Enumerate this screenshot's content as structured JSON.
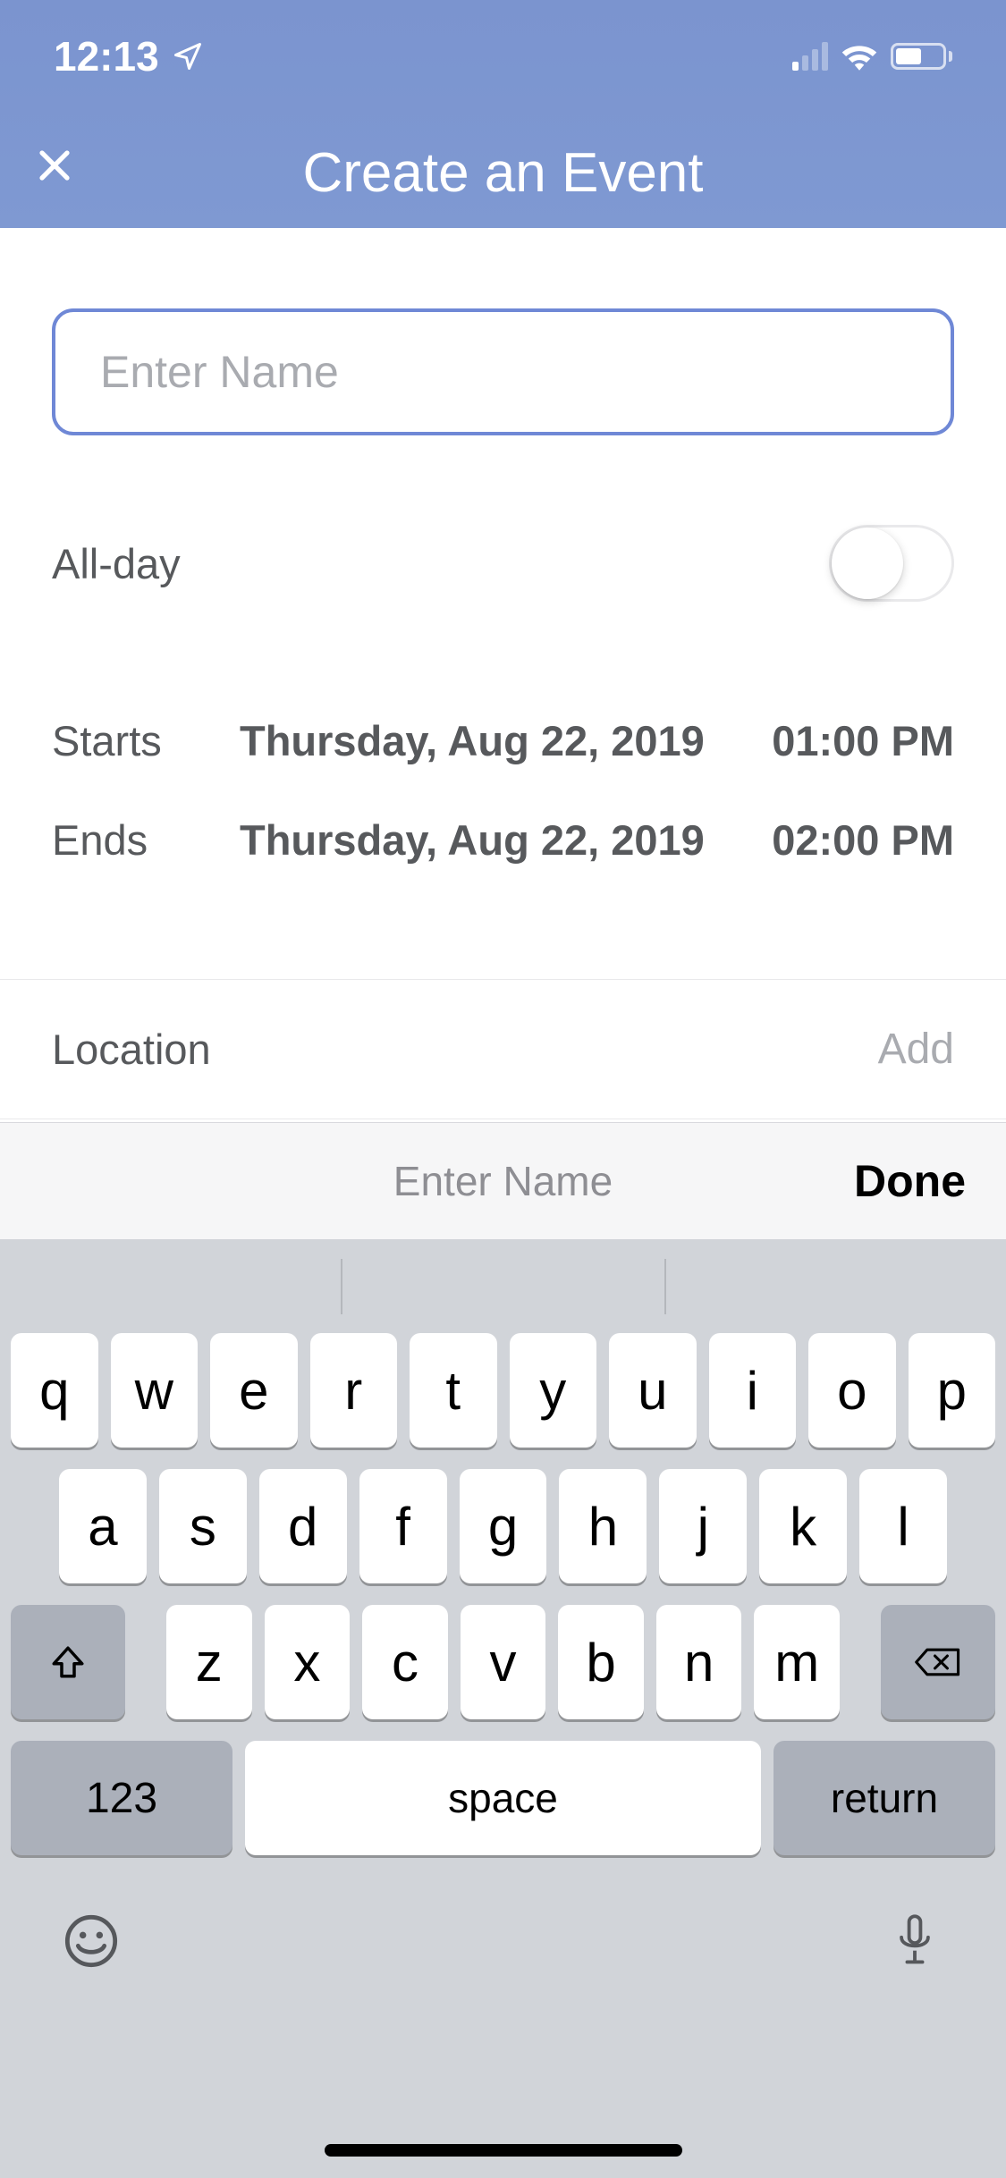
{
  "status_bar": {
    "time": "12:13"
  },
  "nav": {
    "title": "Create an Event"
  },
  "form": {
    "name_placeholder": "Enter Name",
    "all_day_label": "All-day",
    "starts_label": "Starts",
    "starts_date": "Thursday, Aug 22, 2019",
    "starts_time": "01:00 PM",
    "ends_label": "Ends",
    "ends_date": "Thursday, Aug 22, 2019",
    "ends_time": "02:00 PM",
    "location_label": "Location",
    "location_add": "Add"
  },
  "keyboard_accessory": {
    "hint": "Enter Name",
    "done": "Done"
  },
  "keyboard": {
    "row1": [
      "q",
      "w",
      "e",
      "r",
      "t",
      "y",
      "u",
      "i",
      "o",
      "p"
    ],
    "row2": [
      "a",
      "s",
      "d",
      "f",
      "g",
      "h",
      "j",
      "k",
      "l"
    ],
    "row3": [
      "z",
      "x",
      "c",
      "v",
      "b",
      "n",
      "m"
    ],
    "key_123": "123",
    "key_space": "space",
    "key_return": "return"
  }
}
